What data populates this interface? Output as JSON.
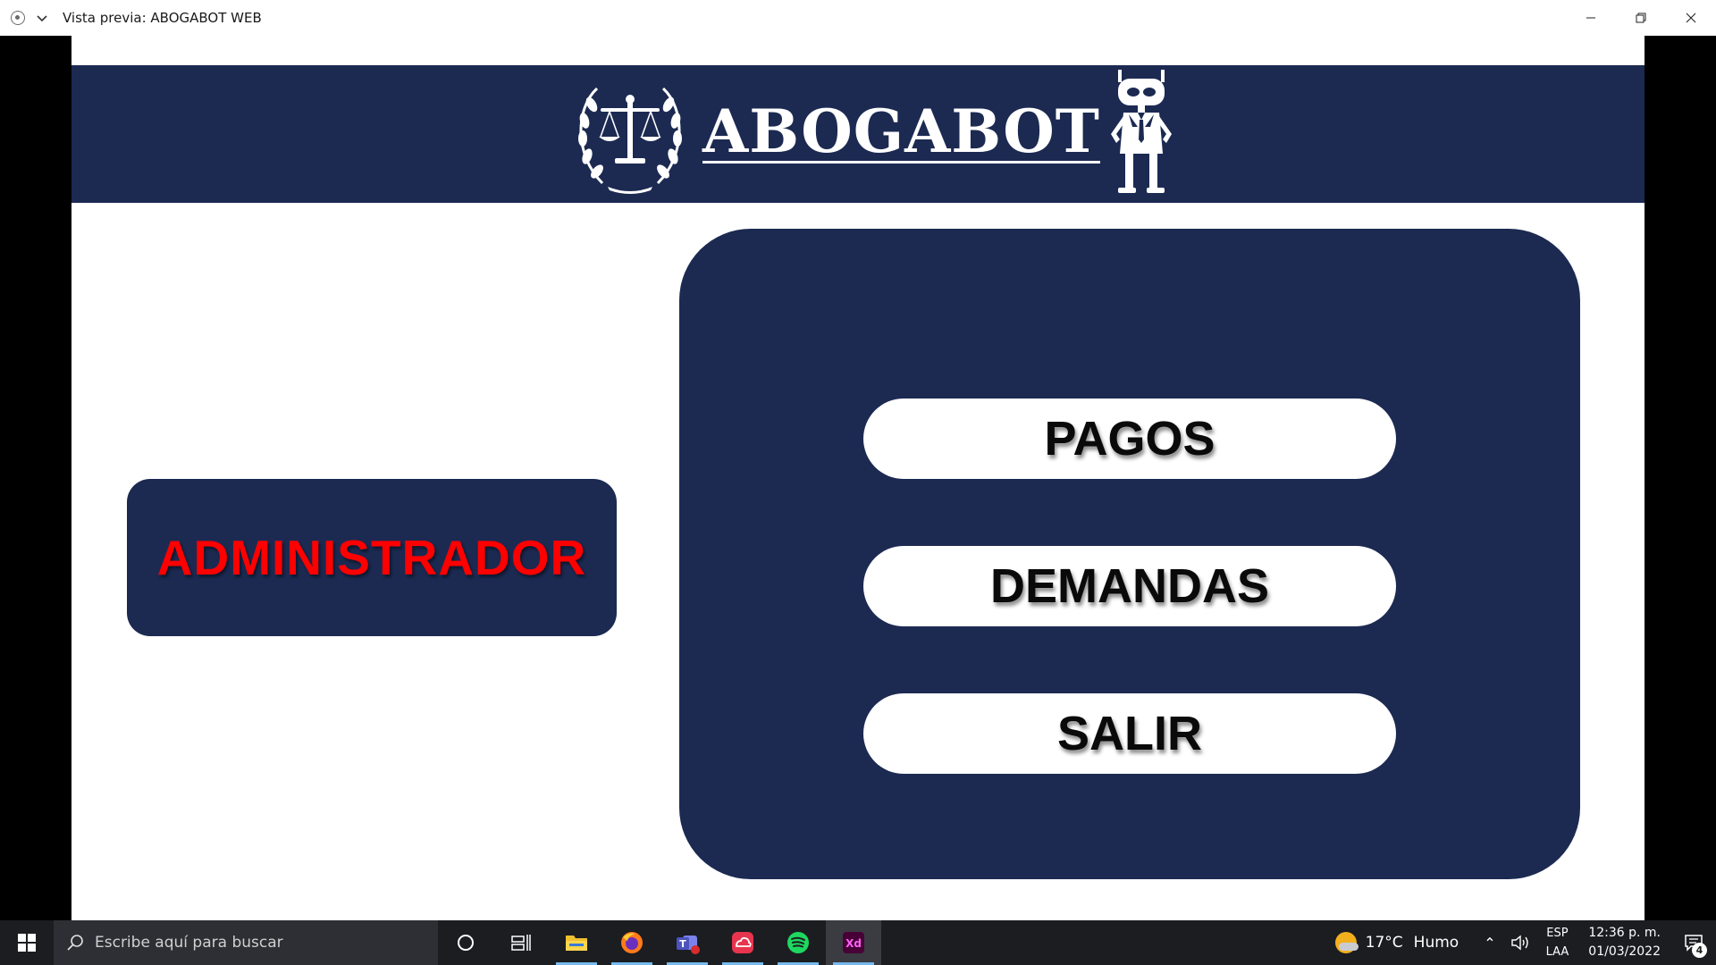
{
  "window": {
    "title": "Vista previa: ABOGABOT WEB",
    "controls": [
      "minimize-icon",
      "restore-icon",
      "close-icon"
    ]
  },
  "app": {
    "brand_name": "ABOGABOT",
    "logo_icons": [
      "scales-of-justice-icon",
      "robot-icon"
    ],
    "role_label": "ADMINISTRADOR",
    "menu": [
      {
        "label": "PAGOS"
      },
      {
        "label": "DEMANDAS"
      },
      {
        "label": "SALIR"
      }
    ],
    "colors": {
      "navy": "#1c2a52",
      "role_text": "#ff0000",
      "button_bg": "#ffffff",
      "button_text": "#0a0a0a"
    }
  },
  "taskbar": {
    "search_placeholder": "Escribe aquí para buscar",
    "apps": [
      "cortana-icon",
      "task-view-icon",
      "file-explorer-icon",
      "firefox-icon",
      "teams-icon",
      "creative-cloud-icon",
      "spotify-icon",
      "adobe-xd-icon"
    ],
    "xd_label": "Xd",
    "weather": {
      "temp": "17°C",
      "condition": "Humo"
    },
    "language": {
      "line1": "ESP",
      "line2": "LAA"
    },
    "clock": {
      "time": "12:36 p. m.",
      "date": "01/03/2022"
    },
    "notifications": "4"
  }
}
